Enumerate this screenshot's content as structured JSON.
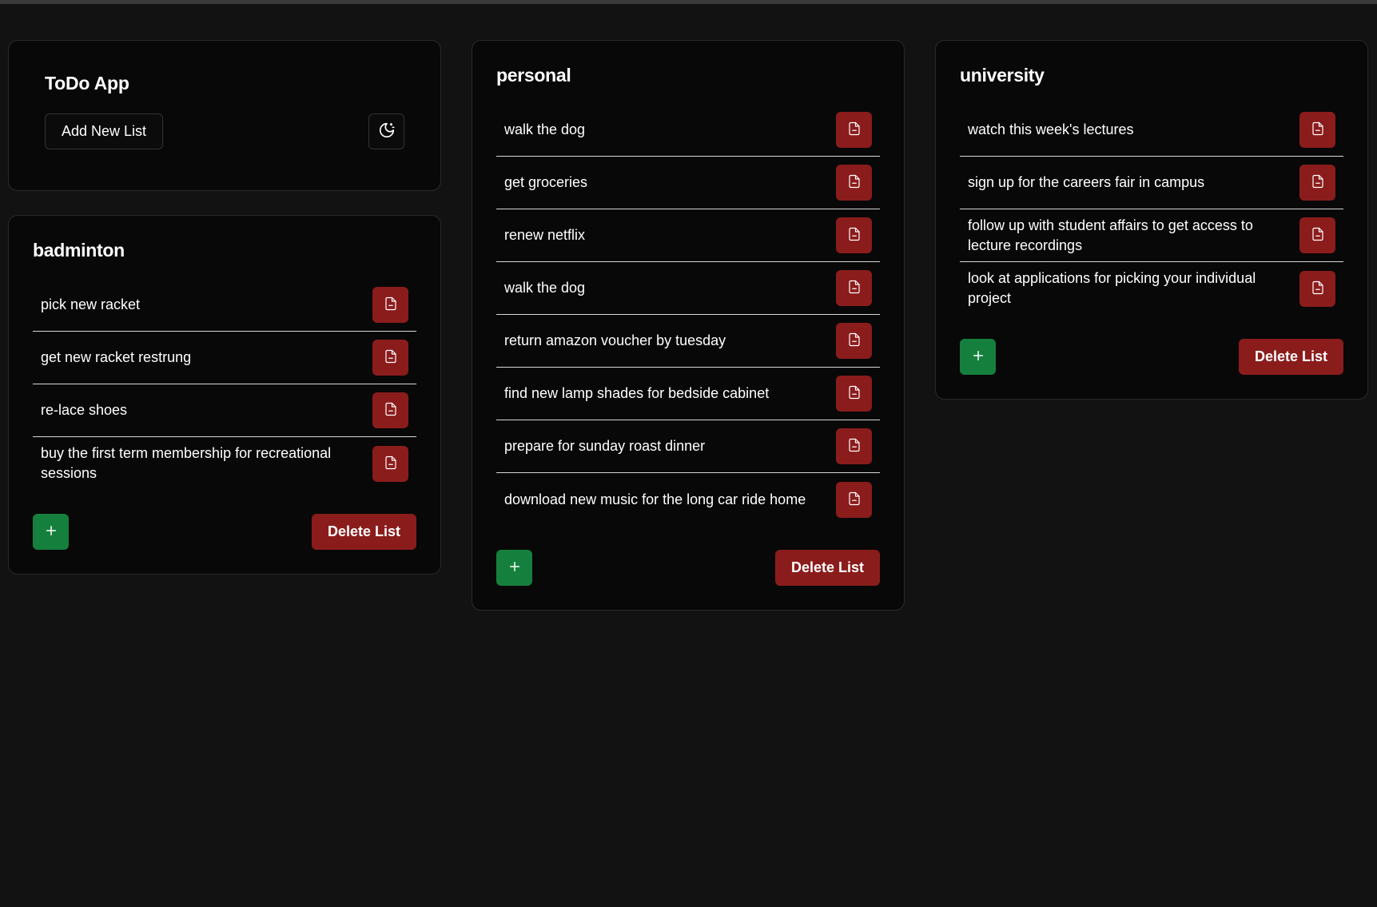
{
  "app": {
    "title": "ToDo App",
    "add_list_label": "Add New List",
    "theme_icon": "moon-stars-icon"
  },
  "colors": {
    "background": "#121212",
    "card": "#080808",
    "danger": "#8b1c1c",
    "success": "#15803d"
  },
  "lists": [
    {
      "title": "badminton",
      "items": [
        "pick new racket",
        "get new racket restrung",
        "re-lace shoes",
        "buy the first term membership for recreational sessions"
      ]
    },
    {
      "title": "personal",
      "items": [
        "walk the dog",
        "get groceries",
        "renew netflix",
        "walk the dog",
        "return amazon voucher by tuesday",
        "find new lamp shades for bedside cabinet",
        "prepare for sunday roast dinner",
        "download new music for the long car ride home"
      ]
    },
    {
      "title": "university",
      "items": [
        "watch this week's lectures",
        "sign up for the careers fair in campus",
        "follow up with student affairs to get access to lecture recordings",
        "look at applications for picking your individual project"
      ]
    }
  ],
  "labels": {
    "delete_list": "Delete List",
    "add_item_icon": "plus-icon",
    "delete_item_icon": "file-minus-icon"
  }
}
